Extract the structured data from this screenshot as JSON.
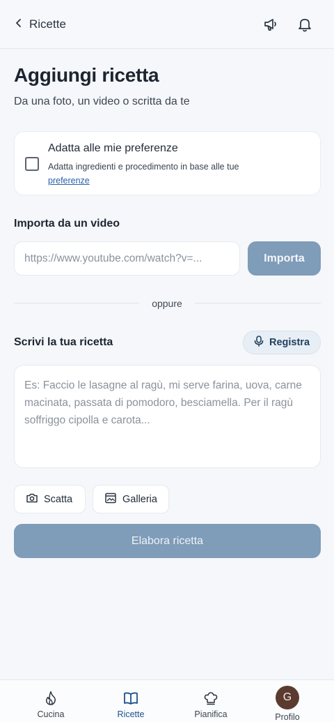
{
  "header": {
    "back_label": "Ricette",
    "icons": [
      "megaphone-icon",
      "bell-icon"
    ]
  },
  "page": {
    "title": "Aggiungi ricetta",
    "subtitle": "Da una foto, un video o scritta da te"
  },
  "preferences": {
    "checked": false,
    "title": "Adatta alle mie preferenze",
    "description": "Adatta ingredienti e procedimento in base alle tue",
    "link": "preferenze"
  },
  "video_import": {
    "label": "Importa da un video",
    "placeholder": "https://www.youtube.com/watch?v=...",
    "button": "Importa"
  },
  "divider": "oppure",
  "write_recipe": {
    "label": "Scrivi la tua ricetta",
    "record_button": "Registra",
    "placeholder": "Es: Faccio le lasagne al ragù, mi serve farina, uova, carne macinata, passata di pomodoro, besciamella. Per il ragù soffriggo cipolla e carota..."
  },
  "media": {
    "camera_button": "Scatta",
    "gallery_button": "Galleria"
  },
  "submit_button": "Elabora ricetta",
  "bottom_nav": [
    {
      "label": "Cucina",
      "icon": "flame-icon",
      "active": false
    },
    {
      "label": "Ricette",
      "icon": "book-icon",
      "active": true
    },
    {
      "label": "Pianifica",
      "icon": "chef-hat-icon",
      "active": false
    },
    {
      "label": "Profilo",
      "icon": "avatar",
      "avatar_letter": "G",
      "active": false
    }
  ],
  "colors": {
    "accent": "#1f4f8a",
    "button_disabled": "#7f9cb9",
    "background": "#f5f7fa",
    "avatar": "#5b3b30"
  }
}
